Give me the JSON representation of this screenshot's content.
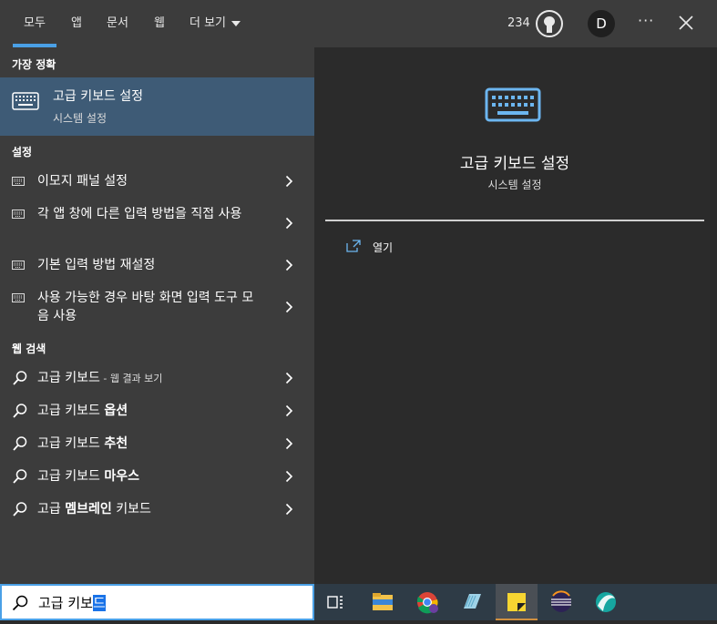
{
  "tabs": [
    {
      "label": "모두",
      "active": true
    },
    {
      "label": "앱"
    },
    {
      "label": "문서"
    },
    {
      "label": "웹"
    },
    {
      "label": "더 보기"
    }
  ],
  "header": {
    "points": "234",
    "avatar_initial": "D",
    "more_label": "···"
  },
  "best_match": {
    "section_label": "가장 정확",
    "title": "고급 키보드 설정",
    "subtitle": "시스템 설정"
  },
  "settings": {
    "section_label": "설정",
    "items": [
      {
        "label": "이모지 패널 설정"
      },
      {
        "label": "각 앱 창에 다른 입력 방법을 직접 사용"
      },
      {
        "label": "기본 입력 방법 재설정"
      },
      {
        "label": "사용 가능한 경우 바탕 화면 입력 도구 모음 사용"
      }
    ]
  },
  "web": {
    "section_label": "웹 검색",
    "items": [
      {
        "query": "고급 키보드",
        "suffix": " - 웹 결과 보기"
      },
      {
        "prefix": "고급 키보드 ",
        "bold": "옵션"
      },
      {
        "prefix": "고급 키보드 ",
        "bold": "추천"
      },
      {
        "prefix": "고급 키보드 ",
        "bold": "마우스"
      },
      {
        "prefix": "고급 ",
        "bold": "멤브레인",
        "suffix": " 키보드"
      }
    ]
  },
  "detail": {
    "title": "고급 키보드 설정",
    "subtitle": "시스템 설정",
    "open_label": "열기"
  },
  "search": {
    "text_before_selection": "고급 키보",
    "selected_text": "드"
  },
  "taskbar": {
    "apps": [
      {
        "icon": "task-view-icon"
      },
      {
        "icon": "file-explorer-icon"
      },
      {
        "icon": "chrome-icon"
      },
      {
        "icon": "notepad-icon"
      },
      {
        "icon": "sticky-notes-icon",
        "active": true
      },
      {
        "icon": "eclipse-icon"
      },
      {
        "icon": "app-icon"
      }
    ]
  },
  "colors": {
    "accent": "#4aa0e6",
    "selected_row": "#3e5b76",
    "panel": "#3c3c3c",
    "detail_bg": "#2b2b2b"
  }
}
